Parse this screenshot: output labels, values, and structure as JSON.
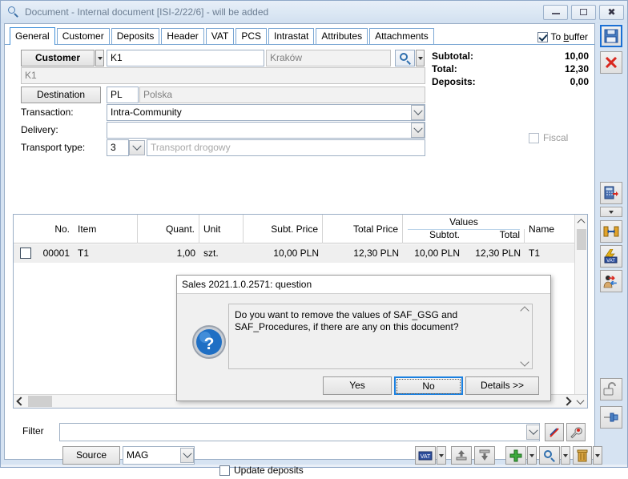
{
  "window": {
    "title": "Document - Internal document [ISI-2/22/6]  - will be added",
    "search_icon": "search-icon",
    "minimize": "minimize-icon",
    "maximize": "maximize-icon",
    "close": "close-icon"
  },
  "tabs": [
    {
      "label": "General",
      "active": true
    },
    {
      "label": "Customer",
      "active": false
    },
    {
      "label": "Deposits",
      "active": false
    },
    {
      "label": "Header",
      "active": false
    },
    {
      "label": "VAT",
      "active": false
    },
    {
      "label": "PCS",
      "active": false
    },
    {
      "label": "Intrastat",
      "active": false
    },
    {
      "label": "Attributes",
      "active": false
    },
    {
      "label": "Attachments",
      "active": false
    }
  ],
  "to_buffer": {
    "label_pre": "To ",
    "label_accel": "b",
    "label_post": "uffer",
    "checked": true
  },
  "form": {
    "customer_button": "Customer",
    "customer_code": "K1",
    "customer_city": "Kraków",
    "customer_name": "K1",
    "destination_button": "Destination",
    "destination_code": "PL",
    "destination_name": "Polska",
    "transaction_label": "Transaction:",
    "transaction_value": "Intra-Community",
    "delivery_label": "Delivery:",
    "delivery_value": "",
    "transport_label": "Transport type:",
    "transport_code": "3",
    "transport_name": "Transport drogowy"
  },
  "totals": {
    "rows": [
      {
        "label": "Subtotal:",
        "value": "10,00"
      },
      {
        "label": "Total:",
        "value": "12,30"
      },
      {
        "label": "Deposits:",
        "value": "0,00"
      }
    ],
    "fiscal_label": "Fiscal",
    "fiscal_checked": false
  },
  "grid": {
    "group_header": "Values",
    "columns": [
      {
        "key": "no",
        "label": "No."
      },
      {
        "key": "item",
        "label": "Item"
      },
      {
        "key": "quant",
        "label": "Quant."
      },
      {
        "key": "unit",
        "label": "Unit"
      },
      {
        "key": "subt_price",
        "label": "Subt. Price"
      },
      {
        "key": "total_price",
        "label": "Total Price"
      },
      {
        "key": "val_subtot",
        "label": "Subtot."
      },
      {
        "key": "val_total",
        "label": "Total"
      },
      {
        "key": "name",
        "label": "Name"
      }
    ],
    "rows": [
      {
        "no": "00001",
        "item": "T1",
        "quant": "1,00",
        "unit": "szt.",
        "subt_price": "10,00 PLN",
        "total_price": "12,30 PLN",
        "val_subtot": "10,00 PLN",
        "val_total": "12,30 PLN",
        "name": "T1"
      }
    ]
  },
  "bottom": {
    "filter_label": "Filter",
    "filter_value": "",
    "source_button": "Source",
    "source_value": "MAG",
    "update_deposits_label": "Update deposits",
    "update_deposits_checked": false,
    "icons": {
      "clear_filter": "clear-filter-icon",
      "filter_builder": "filter-wrench-icon",
      "vat": "vat-icon",
      "export_up": "export-up-icon",
      "import_down": "import-down-icon",
      "add": "plus-icon",
      "preview": "magnifier-icon",
      "delete": "trash-icon"
    }
  },
  "right_toolbar": [
    {
      "name": "save-button",
      "icon": "floppy-disk-icon",
      "selected": true
    },
    {
      "name": "cancel-button",
      "icon": "red-x-icon",
      "selected": false
    },
    {
      "name": "calculate-button",
      "icon": "calculator-arrow-icon",
      "selected": false
    },
    {
      "name": "calculate-dropdown",
      "icon": "chevron-down-icon",
      "selected": false
    },
    {
      "name": "package-button",
      "icon": "package-transfer-icon",
      "selected": false
    },
    {
      "name": "vat-correction-button",
      "icon": "vat-lightning-icon",
      "selected": false
    },
    {
      "name": "customer-relations-button",
      "icon": "person-arrows-icon",
      "selected": false
    },
    {
      "name": "unlock-button",
      "icon": "open-padlock-icon",
      "selected": false
    },
    {
      "name": "pin-button",
      "icon": "pin-icon",
      "selected": false
    }
  ],
  "dialog": {
    "title": "Sales 2021.1.0.2571: question",
    "icon": "question-mark-icon",
    "message": "Do you want to remove the values of SAF_GSG and SAF_Procedures, if there are any on this document?",
    "buttons": [
      {
        "label": "Yes",
        "focused": false
      },
      {
        "label": "No",
        "focused": true
      },
      {
        "label": "Details >>",
        "focused": false
      }
    ]
  }
}
